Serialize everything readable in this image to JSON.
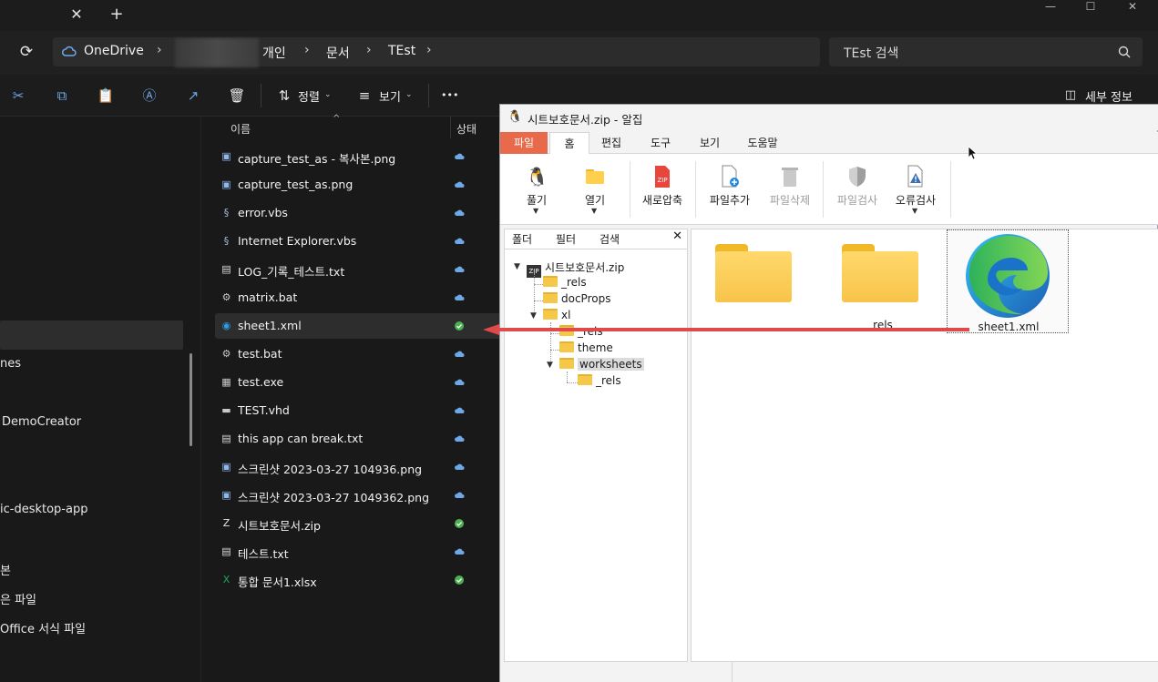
{
  "window": {
    "min": "—",
    "max": "☐",
    "close": "✕"
  },
  "tabbar": {
    "close": "✕",
    "new_tab": "+"
  },
  "address": {
    "crumbs": [
      "OneDrive",
      "개인",
      "문서",
      "TEst"
    ],
    "sep": "›"
  },
  "search": {
    "placeholder": "TEst 검색",
    "icon": "⌕"
  },
  "toolbar": {
    "sort_label": "정렬",
    "view_label": "보기",
    "more": "•••",
    "details_label": "세부 정보"
  },
  "nav": {
    "items": [
      "nes",
      "DemoCreator",
      "ic-desktop-app",
      "본",
      "은 파일",
      "Office 서식 파일"
    ]
  },
  "list": {
    "col_name": "이름",
    "col_status": "상태",
    "files": [
      {
        "name": "capture_test_as - 복사본.png",
        "icon": "image",
        "status": "cloud"
      },
      {
        "name": "capture_test_as.png",
        "icon": "image",
        "status": "cloud"
      },
      {
        "name": "error.vbs",
        "icon": "script",
        "status": "cloud"
      },
      {
        "name": "Internet Explorer.vbs",
        "icon": "script",
        "status": "cloud"
      },
      {
        "name": "LOG_기록_테스트.txt",
        "icon": "text",
        "status": "cloud"
      },
      {
        "name": "matrix.bat",
        "icon": "batch",
        "status": "cloud"
      },
      {
        "name": "sheet1.xml",
        "icon": "edge",
        "status": "synced"
      },
      {
        "name": "test.bat",
        "icon": "batch",
        "status": "cloud"
      },
      {
        "name": "test.exe",
        "icon": "exe",
        "status": "cloud"
      },
      {
        "name": "TEST.vhd",
        "icon": "disk",
        "status": "cloud"
      },
      {
        "name": "this app can break.txt",
        "icon": "text",
        "status": "cloud"
      },
      {
        "name": "스크린샷 2023-03-27 104936.png",
        "icon": "image",
        "status": "cloud"
      },
      {
        "name": "스크린샷 2023-03-27 1049362.png",
        "icon": "image",
        "status": "cloud"
      },
      {
        "name": "시트보호문서.zip",
        "icon": "zip",
        "status": "synced"
      },
      {
        "name": "테스트.txt",
        "icon": "text",
        "status": "cloud"
      },
      {
        "name": "통합 문서1.xlsx",
        "icon": "excel",
        "status": "synced"
      }
    ]
  },
  "alzip": {
    "title": "시트보호문서.zip - 알집",
    "tabs": [
      "파일",
      "홈",
      "편집",
      "도구",
      "보기",
      "도움말"
    ],
    "ribbon": [
      {
        "label": "풀기",
        "icon": "🐧",
        "disabled": false,
        "dropdown": true
      },
      {
        "label": "열기",
        "icon": "📂",
        "disabled": false,
        "dropdown": true
      },
      {
        "label": "새로압축",
        "icon": "ZIP",
        "disabled": false,
        "dropdown": false
      },
      {
        "label": "파일추가",
        "icon": "add-file",
        "disabled": false,
        "dropdown": false
      },
      {
        "label": "파일삭제",
        "icon": "trash",
        "disabled": true,
        "dropdown": false
      },
      {
        "label": "파일검사",
        "icon": "shield",
        "disabled": true,
        "dropdown": false
      },
      {
        "label": "오류검사",
        "icon": "warning",
        "disabled": false,
        "dropdown": true
      }
    ],
    "left_tabs": [
      "폴더",
      "필터",
      "검색"
    ],
    "left_close": "✕",
    "tree": {
      "root": "시트보호문서.zip",
      "rels": "_rels",
      "docProps": "docProps",
      "xl": "xl",
      "xl_rels": "_rels",
      "theme": "theme",
      "worksheets": "worksheets",
      "ws_rels": "_rels"
    },
    "content": [
      {
        "name": "",
        "type": "folder"
      },
      {
        "name": "_rels",
        "type": "folder"
      },
      {
        "name": "sheet1.xml",
        "type": "edge"
      }
    ]
  },
  "colors": {
    "accent_red": "#e04a4a",
    "alzip_file_tab": "#e86a4a",
    "cloud_blue": "#6ea8e8",
    "synced_green": "#4caf50"
  }
}
